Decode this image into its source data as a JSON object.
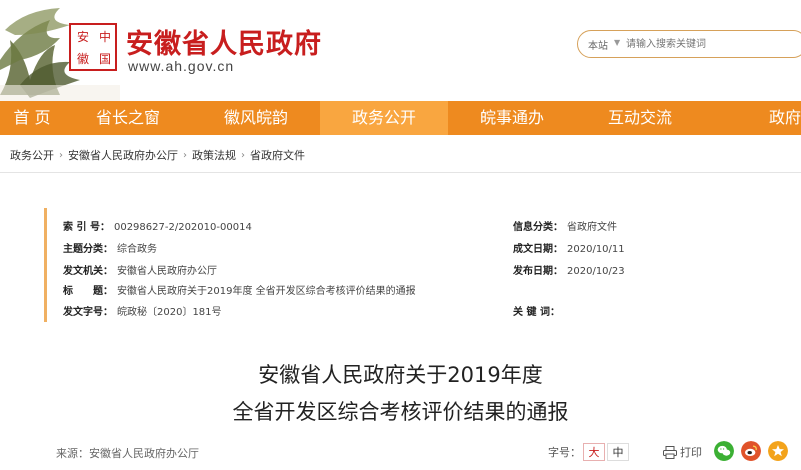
{
  "header": {
    "seal_chars": [
      "安",
      "中",
      "徽",
      "国"
    ],
    "title": "安徽省人民政府",
    "url": "www.ah.gov.cn",
    "search": {
      "scope": "本站",
      "placeholder": "请输入搜索关键词"
    }
  },
  "nav": {
    "items": [
      {
        "label": "首 页"
      },
      {
        "label": "省长之窗"
      },
      {
        "label": "徽风皖韵"
      },
      {
        "label": "政务公开"
      },
      {
        "label": "皖事通办"
      },
      {
        "label": "互动交流"
      },
      {
        "label": "政府"
      }
    ],
    "active_index": 3,
    "colors": {
      "bar": "#ee8a1f",
      "active": "#f9a640"
    }
  },
  "breadcrumb": [
    "政务公开",
    "安徽省人民政府办公厅",
    "政策法规",
    "省政府文件"
  ],
  "meta": {
    "index_no": {
      "key": "索 引 号：",
      "value": "00298627-2/202010-00014"
    },
    "info_category": {
      "key": "信息分类：",
      "value": "省政府文件"
    },
    "topic_category": {
      "key": "主题分类：",
      "value": "综合政务"
    },
    "created_date": {
      "key": "成文日期：",
      "value": "2020/10/11"
    },
    "issuer": {
      "key": "发文机关：",
      "value": "安徽省人民政府办公厅"
    },
    "publish_date": {
      "key": "发布日期：",
      "value": "2020/10/23"
    },
    "subject": {
      "key": "标　　题：",
      "value": "安徽省人民政府关于2019年度 全省开发区综合考核评价结果的通报"
    },
    "doc_no": {
      "key": "发文字号：",
      "value": "皖政秘〔2020〕181号"
    },
    "keywords": {
      "key": "关 键 词：",
      "value": ""
    }
  },
  "article": {
    "title_line1": "安徽省人民政府关于2019年度",
    "title_line2": "全省开发区综合考核评价结果的通报",
    "source": "来源：安徽省人民政府办公厅",
    "fontsize_label": "字号：",
    "fontsize_large": "大",
    "fontsize_medium": "中",
    "print_label": "打印",
    "share": [
      {
        "icon": "wechat-icon",
        "color": "#3cb034"
      },
      {
        "icon": "weibo-icon",
        "color": "#e0532a"
      },
      {
        "icon": "favorite-star-icon",
        "color": "#f3a31b"
      }
    ]
  }
}
